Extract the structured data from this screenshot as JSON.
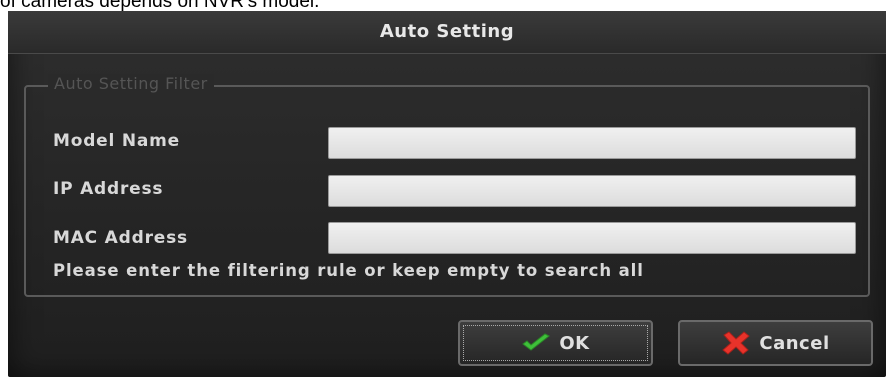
{
  "caption": "of cameras depends on NVR's model.",
  "dialog": {
    "title": "Auto Setting",
    "filter_legend": "Auto Setting Filter",
    "fields": [
      {
        "label": "Model Name",
        "value": ""
      },
      {
        "label": "IP Address",
        "value": ""
      },
      {
        "label": "MAC Address",
        "value": ""
      }
    ],
    "hint": "Please enter the filtering rule or keep empty to search all",
    "ok_label": "OK",
    "cancel_label": "Cancel",
    "ok_icon": "checkmark-icon",
    "cancel_icon": "x-mark-icon",
    "colors": {
      "ok_icon": "#3fbf3a",
      "cancel_icon": "#e8322a",
      "dialog_bg": "#2a2a2a",
      "input_bg": "#e6e6e6"
    }
  }
}
